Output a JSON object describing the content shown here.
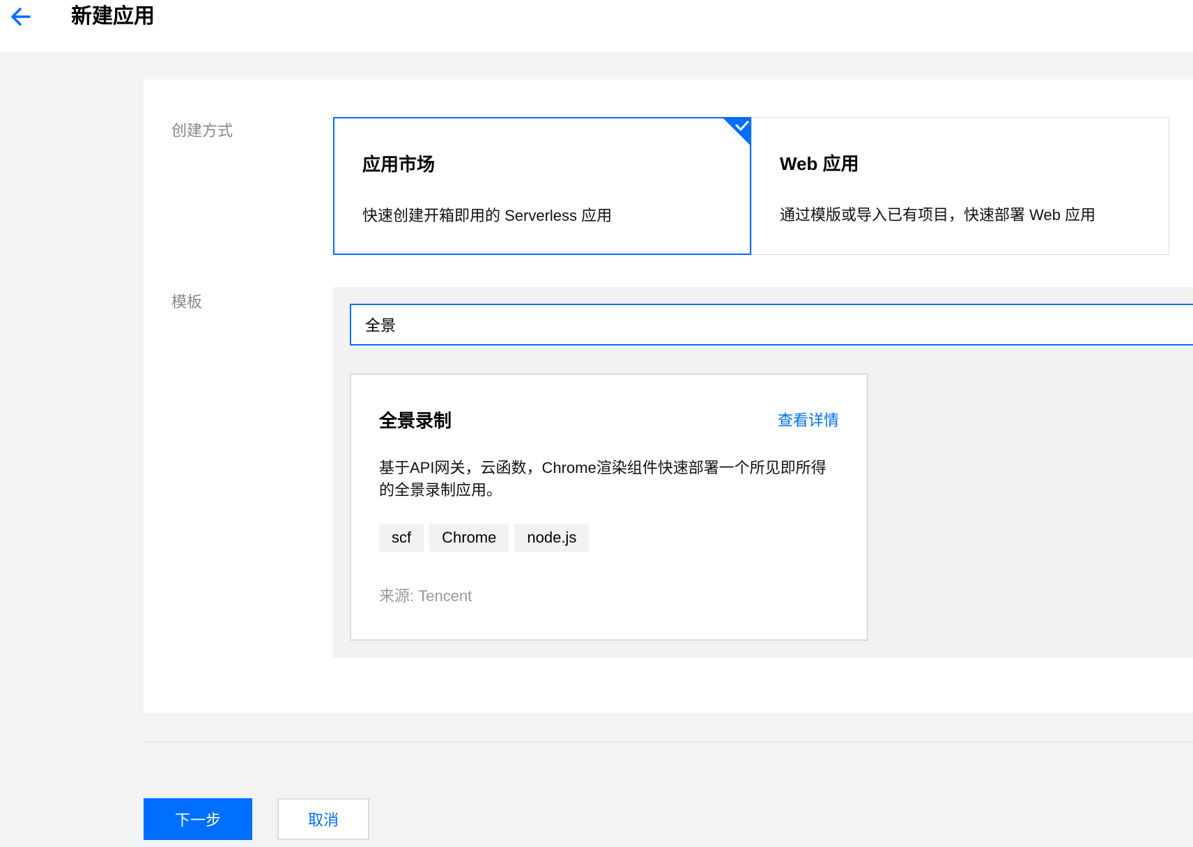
{
  "header": {
    "title": "新建应用",
    "back_icon": "arrow-left-icon"
  },
  "form": {
    "create_method_label": "创建方式",
    "template_label": "模板"
  },
  "methods": [
    {
      "title": "应用市场",
      "desc": "快速创建开箱即用的 Serverless 应用",
      "selected": true
    },
    {
      "title": "Web 应用",
      "desc": "通过模版或导入已有项目，快速部署 Web 应用",
      "selected": false
    }
  ],
  "search": {
    "value": "全景"
  },
  "template_card": {
    "title": "全景录制",
    "link": "查看详情",
    "desc": "基于API网关，云函数，Chrome渲染组件快速部署一个所见即所得的全景录制应用。",
    "tags": [
      "scf",
      "Chrome",
      "node.js"
    ],
    "source": "来源: Tencent"
  },
  "footer": {
    "next_label": "下一步",
    "cancel_label": "取消"
  },
  "colors": {
    "accent": "#006eff",
    "muted_text": "#888888",
    "background": "#f2f3f5"
  }
}
